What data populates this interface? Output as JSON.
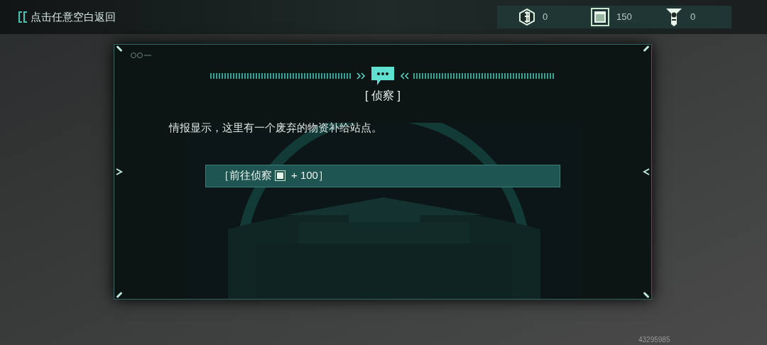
{
  "back_hint": "点击任意空白返回",
  "resources": [
    {
      "kind": "coin",
      "value": "0"
    },
    {
      "kind": "crate",
      "value": "150"
    },
    {
      "kind": "ticket",
      "value": "0"
    }
  ],
  "panel": {
    "title": "[ 侦察 ]",
    "message": "情报显示，这里有一个废弃的物资补给站点。",
    "options": [
      {
        "label": "［前往侦察",
        "reward": "+ 100］"
      }
    ]
  },
  "uid": "43295985"
}
